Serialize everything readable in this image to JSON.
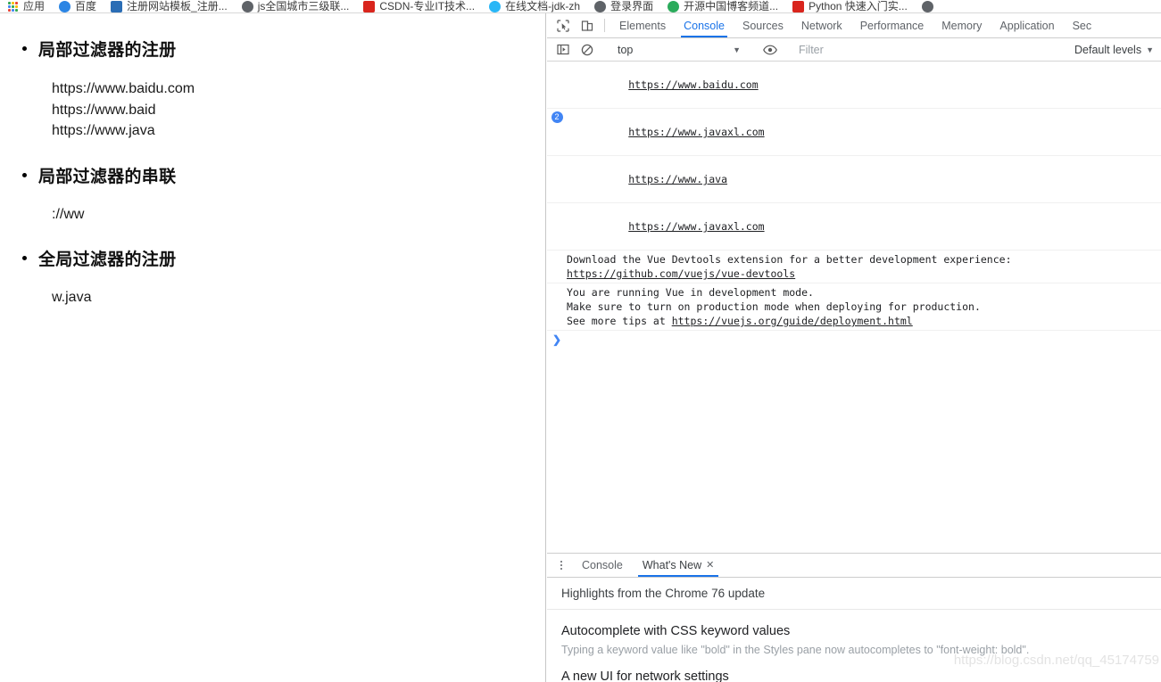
{
  "bookmarks": {
    "items": [
      {
        "label": "应用",
        "icon": "apps-grid-icon",
        "icon_class": "ico-apps"
      },
      {
        "label": "百度",
        "icon": "baidu-icon",
        "icon_class": "ico-baidu"
      },
      {
        "label": "注册网站模板_注册...",
        "icon": "site-icon",
        "icon_class": "ico-blue-sq"
      },
      {
        "label": "js全国城市三级联...",
        "icon": "globe-icon",
        "icon_class": "ico-gray"
      },
      {
        "label": "CSDN-专业IT技术...",
        "icon": "csdn-icon",
        "icon_class": "ico-red"
      },
      {
        "label": "在线文档-jdk-zh",
        "icon": "doc-icon",
        "icon_class": "ico-cyan"
      },
      {
        "label": "登录界面",
        "icon": "login-icon",
        "icon_class": "ico-gray"
      },
      {
        "label": "开源中国博客频道...",
        "icon": "oschina-icon",
        "icon_class": "ico-green"
      },
      {
        "label": "Python 快速入门实...",
        "icon": "csdn-icon",
        "icon_class": "ico-red"
      },
      {
        "label": "",
        "icon": "globe-icon",
        "icon_class": "ico-gray"
      }
    ]
  },
  "page": {
    "sections": [
      {
        "heading": "局部过滤器的注册",
        "body": "https://www.baidu.com\nhttps://www.baid\nhttps://www.java"
      },
      {
        "heading": "局部过滤器的串联",
        "body": "://ww"
      },
      {
        "heading": "全局过滤器的注册",
        "body": "w.java"
      }
    ]
  },
  "devtools": {
    "toolbar_icons": [
      {
        "name": "inspect-element-icon"
      },
      {
        "name": "device-toolbar-icon"
      }
    ],
    "tabs": [
      {
        "label": "Elements",
        "active": false
      },
      {
        "label": "Console",
        "active": true
      },
      {
        "label": "Sources",
        "active": false
      },
      {
        "label": "Network",
        "active": false
      },
      {
        "label": "Performance",
        "active": false
      },
      {
        "label": "Memory",
        "active": false
      },
      {
        "label": "Application",
        "active": false
      },
      {
        "label": "Sec",
        "active": false
      }
    ],
    "console_toolbar": {
      "sidebar_toggle_icon": "console-sidebar-icon",
      "clear_icon": "clear-console-icon",
      "context": "top",
      "context_caret": "▼",
      "eye_icon": "create-live-expression-icon",
      "filter_value": "",
      "filter_placeholder": "Filter",
      "levels_label": "Default levels",
      "levels_caret": "▼"
    },
    "messages": [
      {
        "count": "",
        "text": "https://www.baidu.com",
        "link": true
      },
      {
        "count": "2",
        "text": "https://www.javaxl.com",
        "link": true
      },
      {
        "count": "",
        "text": "https://www.java",
        "link": true
      },
      {
        "count": "",
        "text": "https://www.javaxl.com",
        "link": true
      },
      {
        "count": "",
        "text": "Download the Vue Devtools extension for a better development experience:",
        "link": false,
        "sublink": "https://github.com/vuejs/vue-devtools"
      },
      {
        "count": "",
        "text": "You are running Vue in development mode.\nMake sure to turn on production mode when deploying for production.\nSee more tips at ",
        "link": false,
        "inlinelink": "https://vuejs.org/guide/deployment.html"
      }
    ],
    "prompt": {
      "chevron": "❯"
    },
    "drawer": {
      "menu_icon": "more-options-icon",
      "tabs": [
        {
          "label": "Console",
          "active": false,
          "closable": false
        },
        {
          "label": "What's New",
          "active": true,
          "closable": true,
          "close_glyph": "✕"
        }
      ],
      "subtitle": "Highlights from the Chrome 76 update",
      "items": [
        {
          "title": "Autocomplete with CSS keyword values",
          "desc": "Typing a keyword value like \"bold\" in the Styles pane now autocompletes to \"font-weight: bold\"."
        },
        {
          "title": "A new UI for network settings",
          "desc": ""
        }
      ]
    }
  },
  "watermark": "https://blog.csdn.net/qq_45174759"
}
